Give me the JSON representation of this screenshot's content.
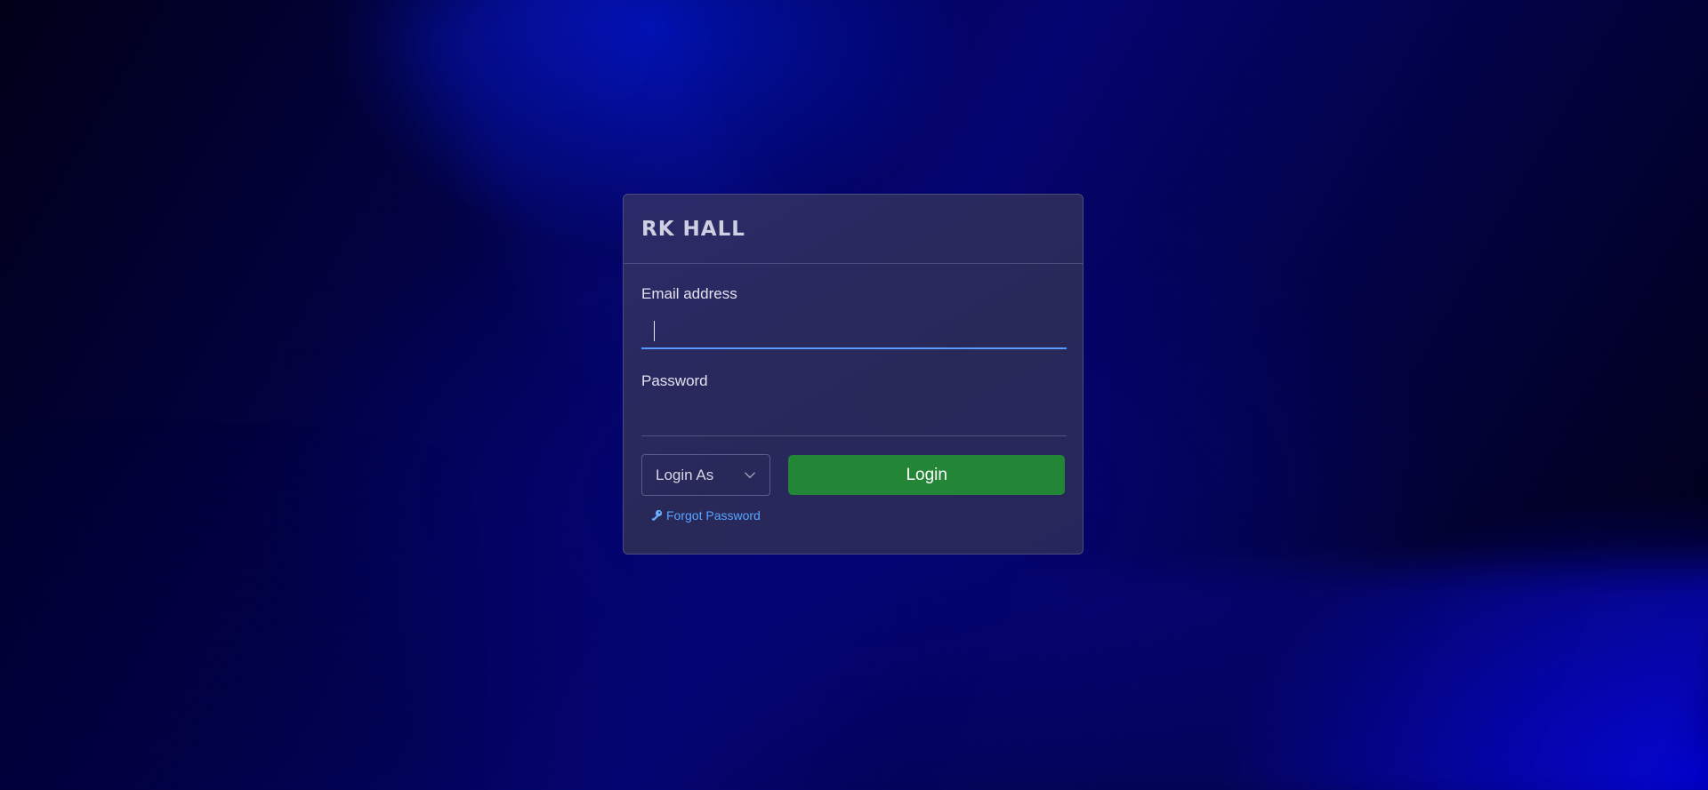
{
  "brand": "RK HALL",
  "email": {
    "label": "Email address",
    "value": "",
    "placeholder": ""
  },
  "password": {
    "label": "Password",
    "value": "",
    "placeholder": ""
  },
  "login_as": {
    "selected": "Login As",
    "icon": "chevron-down-icon"
  },
  "login_button": "Login",
  "forgot_password": {
    "label": "Forgot Password",
    "icon": "key-icon"
  },
  "colors": {
    "primary_button": "#238636",
    "link": "#58a6ff",
    "focus_underline": "#5a9bff",
    "card_background": "#2c2c62"
  }
}
